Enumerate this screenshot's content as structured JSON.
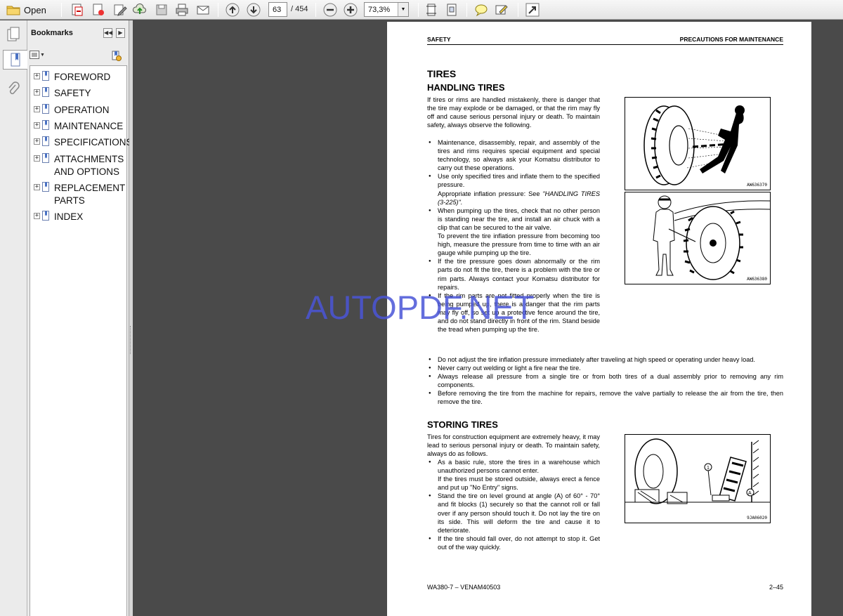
{
  "toolbar": {
    "open_label": "Open",
    "page_current": "63",
    "page_total": "/ 454",
    "zoom": "73,3%"
  },
  "sidebar": {
    "title": "Bookmarks",
    "items": [
      {
        "label": "FOREWORD"
      },
      {
        "label": "SAFETY"
      },
      {
        "label": "OPERATION"
      },
      {
        "label": "MAINTENANCE"
      },
      {
        "label": "SPECIFICATIONS"
      },
      {
        "label": "ATTACHMENTS AND OPTIONS"
      },
      {
        "label": "REPLACEMENT PARTS"
      },
      {
        "label": "INDEX"
      }
    ]
  },
  "doc": {
    "header_left": "SAFETY",
    "header_right": "PRECAUTIONS FOR MAINTENANCE",
    "h_tires": "TIRES",
    "h_handling": "HANDLING TIRES",
    "intro": "If tires or rims are handled mistakenly, there is danger that the tire may explode or be damaged, or that the rim may fly off and cause serious personal injury or death. To maintain safety, always observe the following.",
    "b1": "Maintenance, disassembly, repair, and assembly of the tires and rims requires special equipment and special technology, so always ask your Komatsu distributor to carry out these operations.",
    "b2": "Use only specified tires and inflate them to the specified pressure.",
    "b2_extra": "Appropriate inflation pressure: See",
    "b2_ref": "\"HANDLING TIRES (3-225)\".",
    "b3": "When pumping up the tires, check that no other person is standing near the tire, and install an air chuck with a clip that can be secured to the air valve.",
    "b3_extra": "To prevent the tire inflation pressure from becoming too high, measure the pressure from time to time with an air gauge while pumping up the tire.",
    "b4": "If the tire pressure goes down abnormally or the rim parts do not fit the tire, there is a problem with the tire or rim parts. Always contact your Komatsu distributor for repairs.",
    "b5": "If the rim parts are not fitted properly when the tire is being pumped up, there is a danger that the rim parts may fly off, so set up a protective fence around the tire, and do not stand directly in front of the rim. Stand beside the tread when pumping up the tire.",
    "b6": "Do not adjust the tire inflation pressure immediately after traveling at high speed or operating under heavy load.",
    "b7": "Never carry out welding or light a fire near the tire.",
    "b8": "Always release all pressure from a single tire or from both tires of a dual assembly prior to removing any rim components.",
    "b9": "Before removing the tire from the machine for repairs, remove the valve partially to release the air from the tire, then remove the tire.",
    "h_storing": "STORING TIRES",
    "storing_intro": "Tires for construction equipment are extremely heavy, it may lead to serious personal injury or death. To maintain safety, always do as follows.",
    "s1": "As a basic rule, store the tires in a warehouse which unauthorized persons cannot enter.",
    "s1_extra": "If the tires must be stored outside, always erect a fence and put up \"No Entry\" signs.",
    "s2": "Stand the tire on level ground at angle (A) of 60° - 70° and fit blocks (1) securely so that the cannot roll or fall over if any person should touch it. Do not lay the tire on its side. This will deform the tire and cause it to deteriorate.",
    "s3": "If the tire should fall over, do not attempt to stop it. Get out of the way quickly.",
    "fig1_code": "AW636370",
    "fig2_code": "AW636380",
    "fig3_code": "9JA06020",
    "fig3_label_1": "1",
    "fig3_label_a": "A",
    "footer_left": "WA380-7 – VENAM40503",
    "footer_right": "2–45"
  },
  "watermark": "AUTOPDF.NET"
}
